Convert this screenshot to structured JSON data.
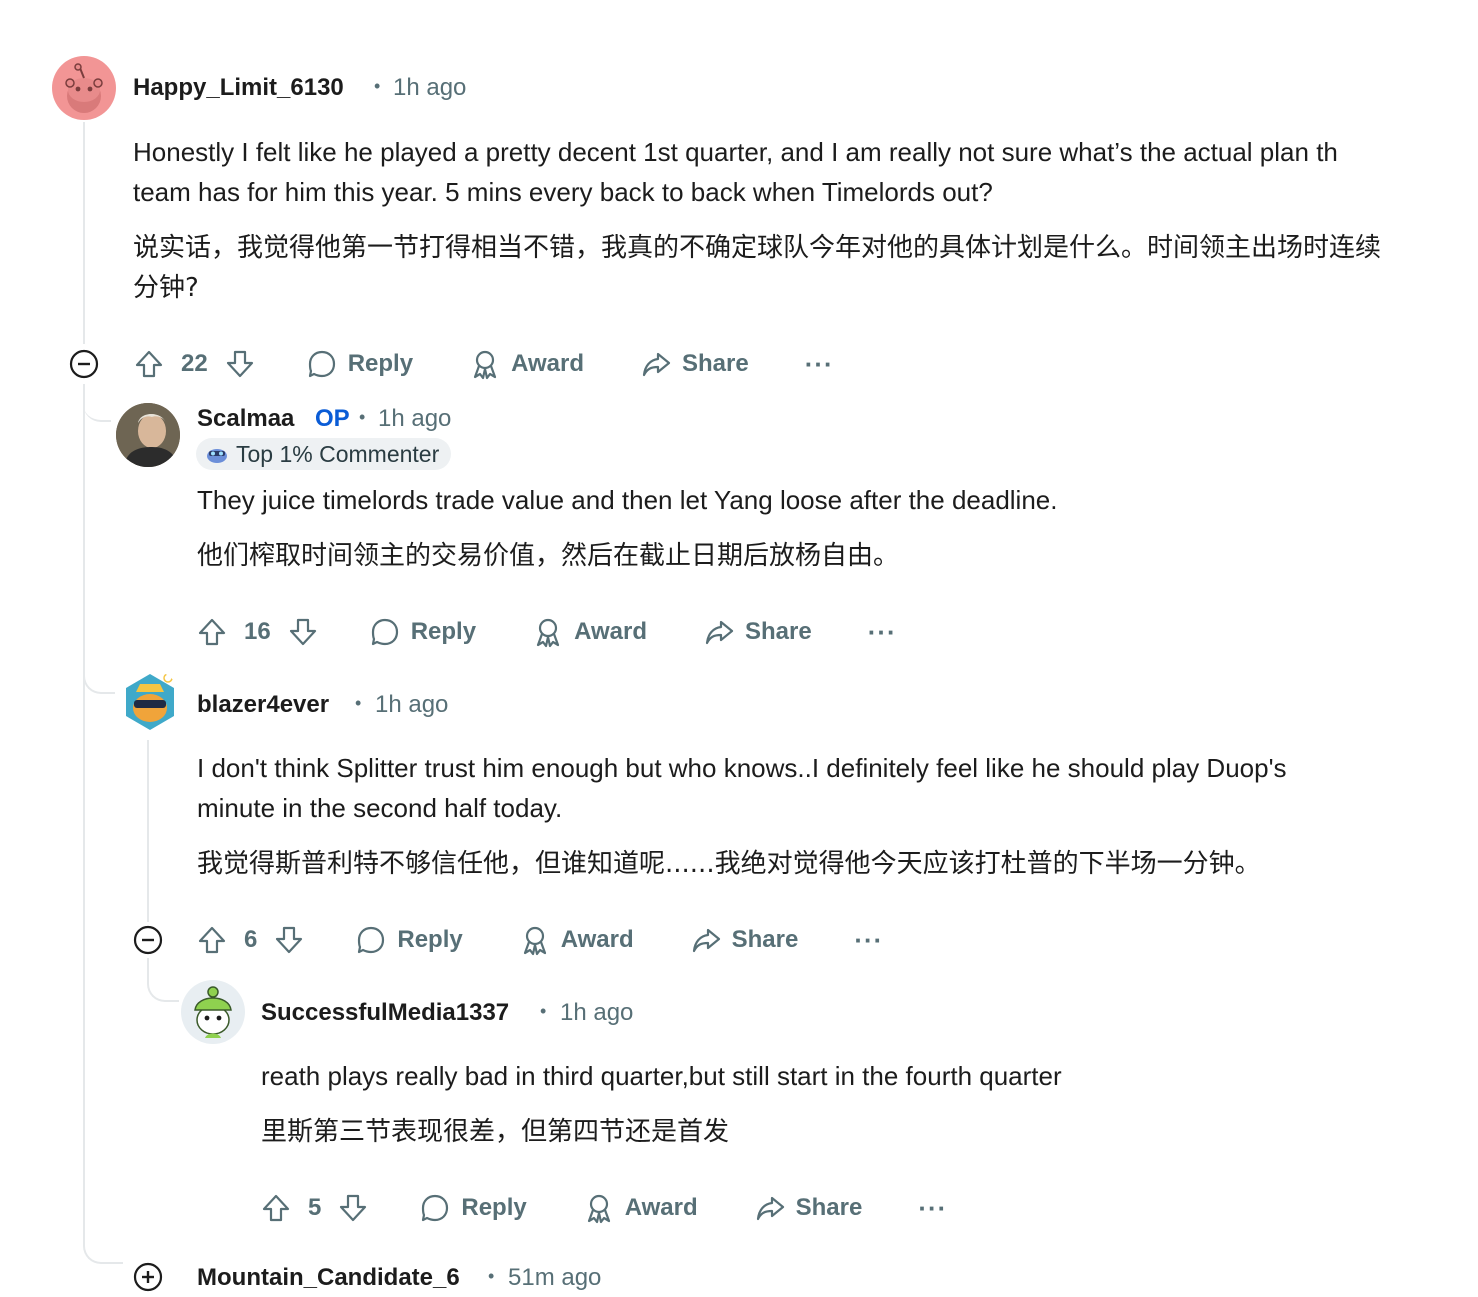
{
  "comments": [
    {
      "username": "Happy_Limit_6130",
      "time": "1h ago",
      "text_lines": [
        "Honestly I felt like he played a pretty decent 1st quarter, and I am really not sure what’s the actual plan th",
        "team has for him this year. 5 mins every back to back when Timelords out?"
      ],
      "translation_lines": [
        "说实话，我觉得他第一节打得相当不错，我真的不确定球队今年对他的具体计划是什么。时间领主出场时连续",
        "分钟?"
      ],
      "score": "22",
      "avatar_color": "#f29595"
    },
    {
      "username": "Scalmaa",
      "op_label": "OP",
      "time": "1h ago",
      "badge": "Top 1% Commenter",
      "text_lines": [
        "They juice timelords trade value and then let Yang loose after the deadline."
      ],
      "translation_lines": [
        "他们榨取时间领主的交易价值，然后在截止日期后放杨自由。"
      ],
      "score": "16"
    },
    {
      "username": "blazer4ever",
      "time": "1h ago",
      "text_lines": [
        "I don't think Splitter trust him enough but who knows..I definitely feel like he should play Duop's",
        "minute in the second half today."
      ],
      "translation_lines": [
        "我觉得斯普利特不够信任他，但谁知道呢......我绝对觉得他今天应该打杜普的下半场一分钟。"
      ],
      "score": "6"
    },
    {
      "username": "SuccessfulMedia1337",
      "time": "1h ago",
      "text_lines": [
        "reath plays really bad in third quarter,but still start in the fourth quarter"
      ],
      "translation_lines": [
        "里斯第三节表现很差，但第四节还是首发"
      ],
      "score": "5"
    },
    {
      "username": "Mountain_Candidate_6",
      "time": "51m ago"
    }
  ],
  "actions": {
    "reply": "Reply",
    "award": "Award",
    "share": "Share",
    "more": "···",
    "separator": "•"
  },
  "colors": {
    "text": "#1c1c1c",
    "meta": "#576f76",
    "op": "#0a5cd6",
    "thread_line": "#e5e8ea"
  }
}
